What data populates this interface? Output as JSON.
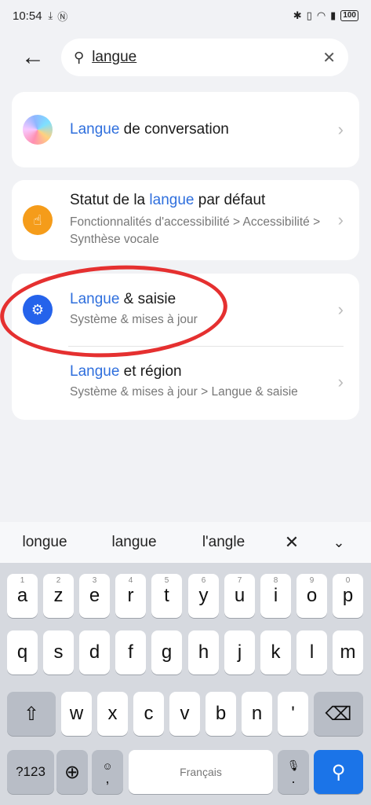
{
  "status": {
    "time": "10:54",
    "battery": "100"
  },
  "search": {
    "value": "langue"
  },
  "results": {
    "card1": {
      "hl": "Langue",
      "rest": " de conversation"
    },
    "card2": {
      "pre": "Statut de la ",
      "hl": "langue",
      "post": " par défaut",
      "sub": "Fonctionnalités d'accessibilité > Accessibilité > Synthèse vocale"
    },
    "card3a": {
      "hl": "Langue",
      "rest": " & saisie",
      "sub": "Système & mises à jour"
    },
    "card3b": {
      "hl": "Langue",
      "rest": " et région",
      "sub": "Système & mises à jour > Langue & saisie"
    }
  },
  "suggestions": [
    "longue",
    "langue",
    "l'angle"
  ],
  "keyboard": {
    "row1": [
      "a",
      "z",
      "e",
      "r",
      "t",
      "y",
      "u",
      "i",
      "o",
      "p"
    ],
    "row1_nums": [
      "1",
      "2",
      "3",
      "4",
      "5",
      "6",
      "7",
      "8",
      "9",
      "0"
    ],
    "row2": [
      "q",
      "s",
      "d",
      "f",
      "g",
      "h",
      "j",
      "k",
      "l",
      "m"
    ],
    "row3": [
      "w",
      "x",
      "c",
      "v",
      "b",
      "n",
      "'"
    ],
    "numbers_label": "?123",
    "comma": ",",
    "period": ".",
    "space_label": "Français"
  },
  "colors": {
    "accent": "#2f6fdd",
    "annotation": "#e53030"
  }
}
